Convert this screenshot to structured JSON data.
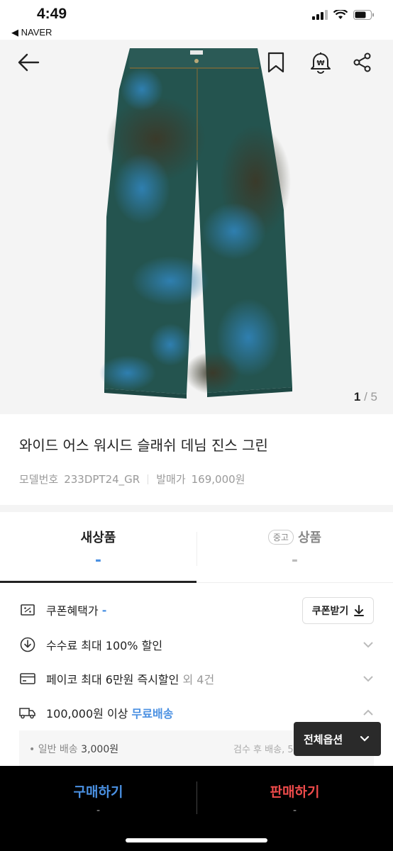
{
  "status_bar": {
    "time": "4:49",
    "back_app": "◀ NAVER"
  },
  "gallery": {
    "current": "1",
    "separator": " / ",
    "total": "5"
  },
  "product": {
    "title": "와이드 어스 워시드 슬래쉬 데님 진스 그린",
    "model_label": "모델번호",
    "model_number": "233DPT24_GR",
    "release_label": "발매가",
    "release_price": "169,000원"
  },
  "tabs": [
    {
      "label": "새상품",
      "value": "-",
      "active": true
    },
    {
      "badge": "중고",
      "label": "상품",
      "value": "-",
      "active": false
    }
  ],
  "benefits": {
    "coupon_price_label": "쿠폰혜택가",
    "coupon_price_value": "-",
    "coupon_button": "쿠폰받기",
    "fee_text": "수수료 최대 100% 할인",
    "payco_text": "페이코 최대 6만원 즉시할인",
    "payco_extra": "외 4건",
    "shipping_prefix": "100,000원 이상",
    "shipping_free": "무료배송",
    "general_shipping_label": "일반 배송",
    "general_shipping_fee": "3,000원",
    "inspection_text": "검수 후 배송, 5"
  },
  "all_options_label": "전체옵션",
  "bottom_bar": {
    "buy_label": "구매하기",
    "buy_sub": "-",
    "sell_label": "판매하기",
    "sell_sub": "-"
  },
  "colors": {
    "accent_blue": "#4a90e2",
    "sell_red": "#ef4b4b",
    "bar_bg": "#000000"
  }
}
